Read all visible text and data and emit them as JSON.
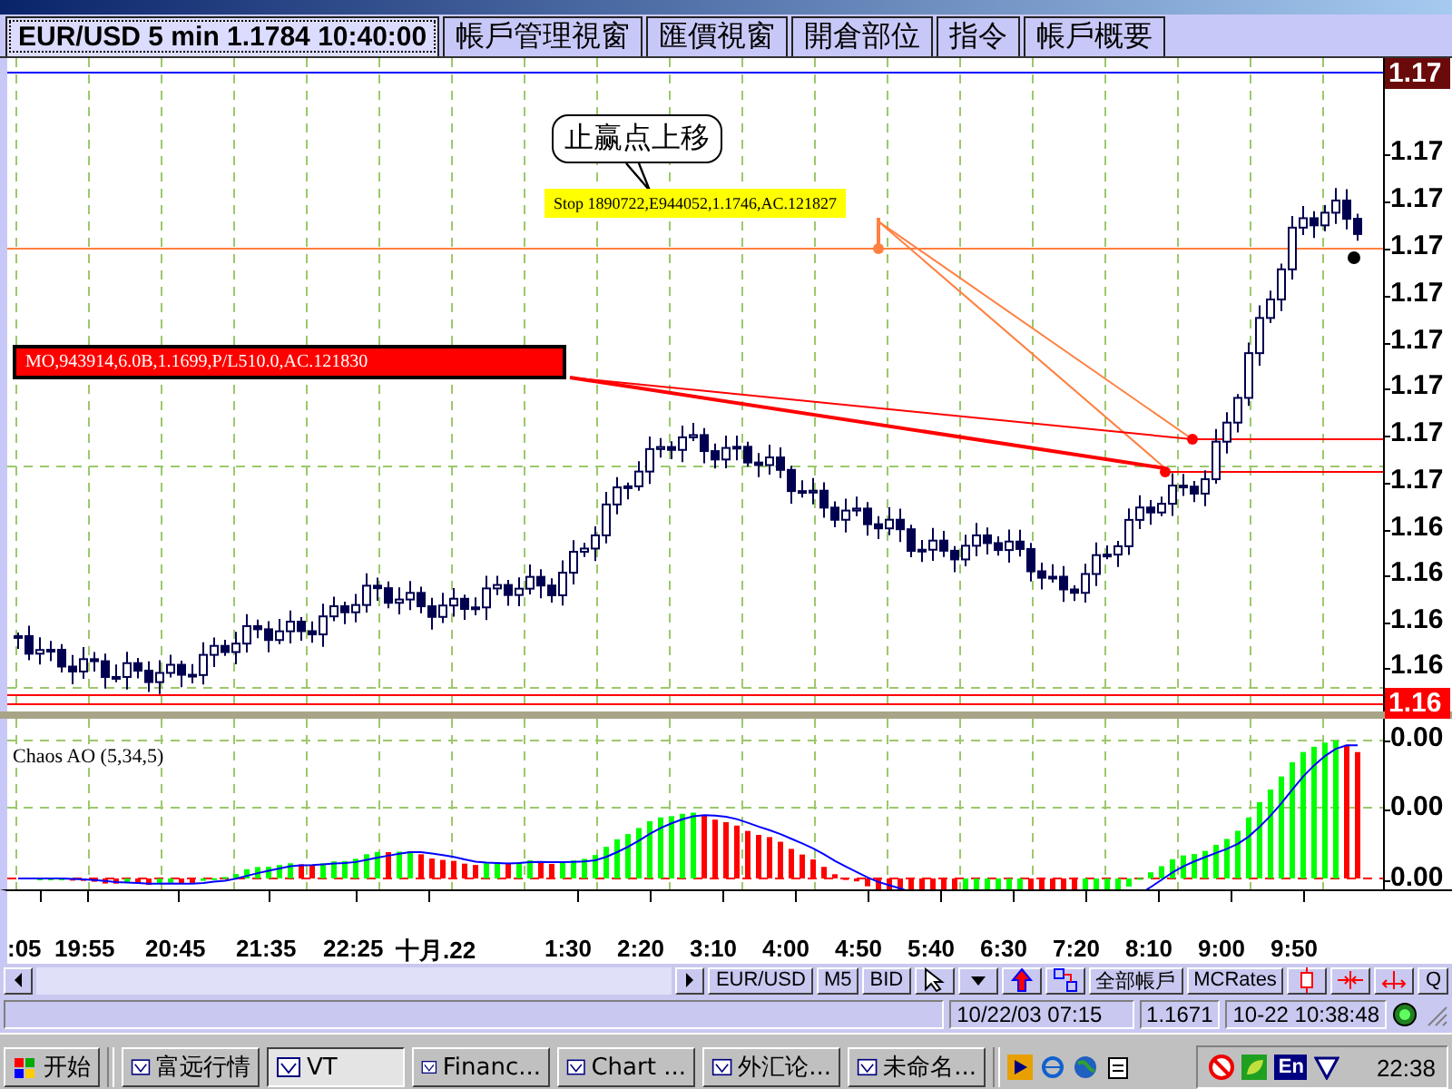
{
  "tabs": [
    {
      "label": "EUR/USD 5 min 1.1784 10:40:00",
      "selected": true
    },
    {
      "label": "帳戶管理視窗",
      "selected": false
    },
    {
      "label": "匯價視窗",
      "selected": false
    },
    {
      "label": "開倉部位",
      "selected": false
    },
    {
      "label": "指令",
      "selected": false
    },
    {
      "label": "帳戶概要",
      "selected": false
    }
  ],
  "price_chart": {
    "callout": "止赢点上移",
    "stop_order_label": "Stop 1890722,E944052,1.1746,AC.121827",
    "open_order_label": "MO,943914,6.0B,1.1699,P/L510.0,AC.121830",
    "current_price": "1.17",
    "low_price": "1.16",
    "axis_labels": [
      "1.17",
      "1.17",
      "1.17",
      "1.17",
      "1.17",
      "1.17",
      "1.17",
      "1.17",
      "1.16",
      "1.16",
      "1.16",
      "1.16"
    ]
  },
  "indicator": {
    "title": "Chaos AO (5,34,5)",
    "axis_labels": [
      "0.00",
      "0.00",
      "0.00"
    ]
  },
  "time_axis": [
    ":05",
    "19:55",
    "20:45",
    "21:35",
    "22:25",
    "十月.22",
    "1:30",
    "2:20",
    "3:10",
    "4:00",
    "4:50",
    "5:40",
    "6:30",
    "7:20",
    "8:10",
    "9:00",
    "9:50"
  ],
  "toolbar": {
    "symbol": "EUR/USD",
    "period": "M5",
    "price_type": "BID",
    "accounts": "全部帳戶",
    "rates": "MCRates",
    "quit": "Q"
  },
  "status_bar": {
    "bar_time": "10/22/03 07:15",
    "bar_price": "1.1671",
    "clock": "10-22 10:38:48"
  },
  "taskbar": {
    "start": "开始",
    "tasks": [
      {
        "label": "富远行情",
        "selected": false
      },
      {
        "label": "VT",
        "selected": true
      },
      {
        "label": "Financ...",
        "selected": false
      },
      {
        "label": "Chart ...",
        "selected": false
      },
      {
        "label": "外汇论...",
        "selected": false
      },
      {
        "label": "未命名...",
        "selected": false
      }
    ],
    "language": "En",
    "time": "22:38"
  }
}
